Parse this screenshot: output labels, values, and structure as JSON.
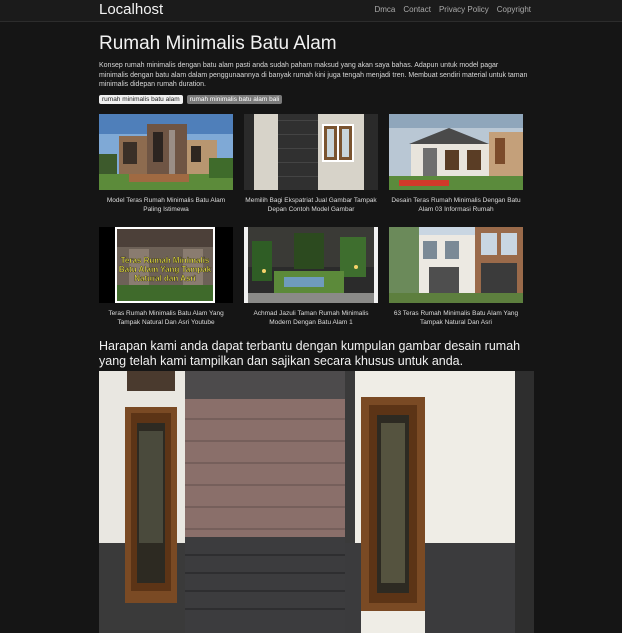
{
  "navbar": {
    "brand": "Localhost",
    "links": [
      "Dmca",
      "Contact",
      "Privacy Policy",
      "Copyright"
    ]
  },
  "page": {
    "title": "Rumah Minimalis Batu Alam",
    "intro": "Konsep rumah minimalis dengan batu alam pasti anda sudah paham maksud yang akan saya bahas. Adapun untuk model pagar minimalis dengan batu alam dalam penggunaannya di banyak rumah kini juga tengah menjadi tren. Membuat sendiri material untuk taman minimalis didepan rumah duration.",
    "tags": [
      "rumah minimalis batu alam",
      "rumah minimalis batu alam bali"
    ],
    "subheading": "Harapan kami anda dapat terbantu dengan kumpulan gambar desain rumah yang telah kami tampilkan dan sajikan secara khusus untuk anda."
  },
  "gallery": [
    {
      "caption": "Model Teras Rumah Minimalis Batu Alam Paling Istimewa"
    },
    {
      "caption": "Memilih Bagi Ekspatriat Jual Gambar Tampak Depan Contoh Model Gambar"
    },
    {
      "caption": "Desain Teras Rumah Minimalis Dengan Batu Alam 03 Informasi Rumah"
    },
    {
      "caption": "Teras Rumah Minimalis Batu Alam Yang Tampak Natural Dan Asri Youtube",
      "overlay": "Teras Rumah Minimalis Batu Alam Yang Tampak Natural dan Asri"
    },
    {
      "caption": "Achmad Jazuli Taman Rumah Minimalis Modern Dengan Batu Alam 1"
    },
    {
      "caption": "63 Teras Rumah Minimalis Batu Alam Yang Tampak Natural Dan Asri"
    }
  ]
}
